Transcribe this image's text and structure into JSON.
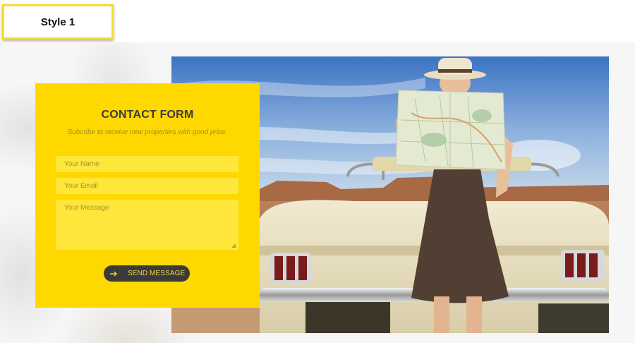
{
  "style_label": "Style 1",
  "contact_form": {
    "title": "CONTACT FORM",
    "subtitle": "Subcribe to receive new properties with good price.",
    "name_placeholder": "Your Name",
    "email_placeholder": "Your Email",
    "message_placeholder": "Your Message",
    "send_label": "SEND MESSAGE",
    "send_icon": "arrow-right-icon"
  },
  "colors": {
    "card_background": "#ffd800",
    "field_background": "#ffe63a",
    "button_background": "#3a3a3a",
    "label_border": "#f5dd2b"
  }
}
